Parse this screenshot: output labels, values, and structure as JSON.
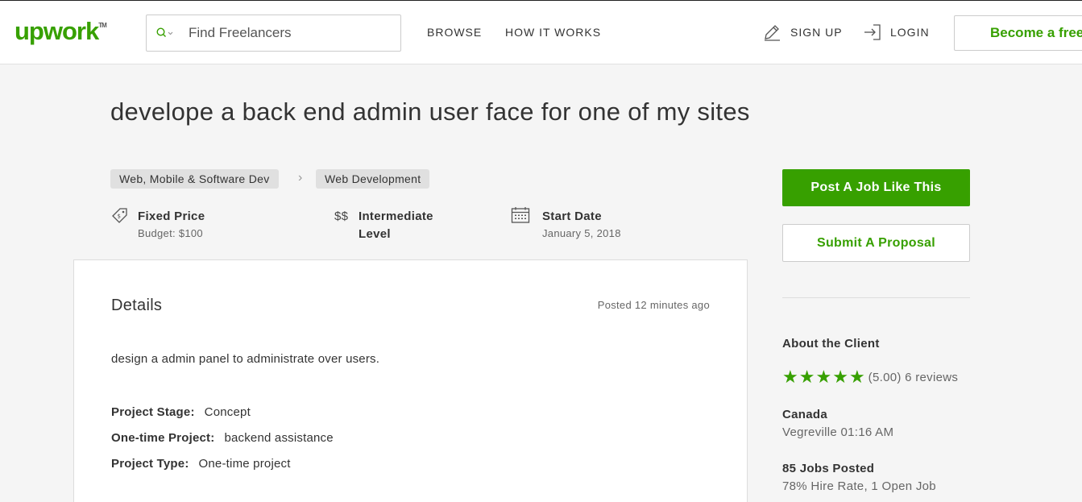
{
  "header": {
    "logo": "upwork",
    "logo_tm": "TM",
    "search_placeholder": "Find Freelancers",
    "nav": {
      "browse": "BROWSE",
      "how_it_works": "HOW IT WORKS",
      "sign_up": "SIGN UP",
      "login": "LOGIN"
    },
    "become": "Become a freelancer",
    "brand_color": "#37a000"
  },
  "job": {
    "title": "develope a back end admin user face for one of my sites",
    "categories": [
      "Web, Mobile & Software Dev",
      "Web Development"
    ],
    "price_type": "Fixed Price",
    "budget": "Budget: $100",
    "level_symbol": "$$",
    "level_line1": "Intermediate",
    "level_line2": "Level",
    "start_label": "Start Date",
    "start_date": "January 5, 2018"
  },
  "details": {
    "heading": "Details",
    "posted": "Posted 12 minutes ago",
    "description": "design a admin panel to administrate over users.",
    "properties": [
      {
        "label": "Project Stage:",
        "value": "Concept"
      },
      {
        "label": "One-time Project:",
        "value": "backend assistance"
      },
      {
        "label": "Project Type:",
        "value": "One-time project"
      }
    ]
  },
  "sidebar": {
    "post_job": "Post A Job Like This",
    "submit_proposal": "Submit A Proposal",
    "about_client": "About the Client",
    "rating_stars": 5,
    "rating_text": "(5.00) 6 reviews",
    "country": "Canada",
    "location_time": "Vegreville 01:16 AM",
    "jobs_posted": "85 Jobs Posted",
    "hire_rate": "78% Hire Rate, 1 Open Job"
  }
}
